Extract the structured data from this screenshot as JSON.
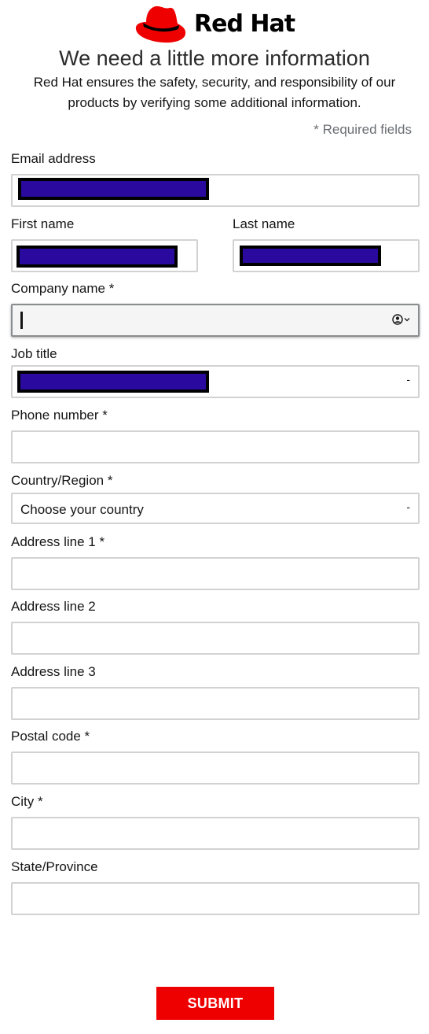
{
  "brand": {
    "name": "Red Hat"
  },
  "header": {
    "title": "We need a little more information",
    "subtitle": "Red Hat ensures the safety, security, and responsibility of our products by verifying some additional information."
  },
  "required_note": "* Required fields",
  "fields": {
    "email": {
      "label": "Email address",
      "value": ""
    },
    "first_name": {
      "label": "First name",
      "value": ""
    },
    "last_name": {
      "label": "Last name",
      "value": ""
    },
    "company": {
      "label": "Company name *",
      "value": ""
    },
    "job_title": {
      "label": "Job title",
      "value": ""
    },
    "phone": {
      "label": "Phone number *",
      "value": ""
    },
    "country": {
      "label": "Country/Region *",
      "selected": "Choose your country"
    },
    "address1": {
      "label": "Address line 1 *",
      "value": ""
    },
    "address2": {
      "label": "Address line 2",
      "value": ""
    },
    "address3": {
      "label": "Address line 3",
      "value": ""
    },
    "postal": {
      "label": "Postal code *",
      "value": ""
    },
    "city": {
      "label": "City *",
      "value": ""
    },
    "state": {
      "label": "State/Province",
      "value": ""
    }
  },
  "submit_label": "SUBMIT",
  "colors": {
    "brand_red": "#ee0000",
    "redaction": "#2a0a9e"
  }
}
